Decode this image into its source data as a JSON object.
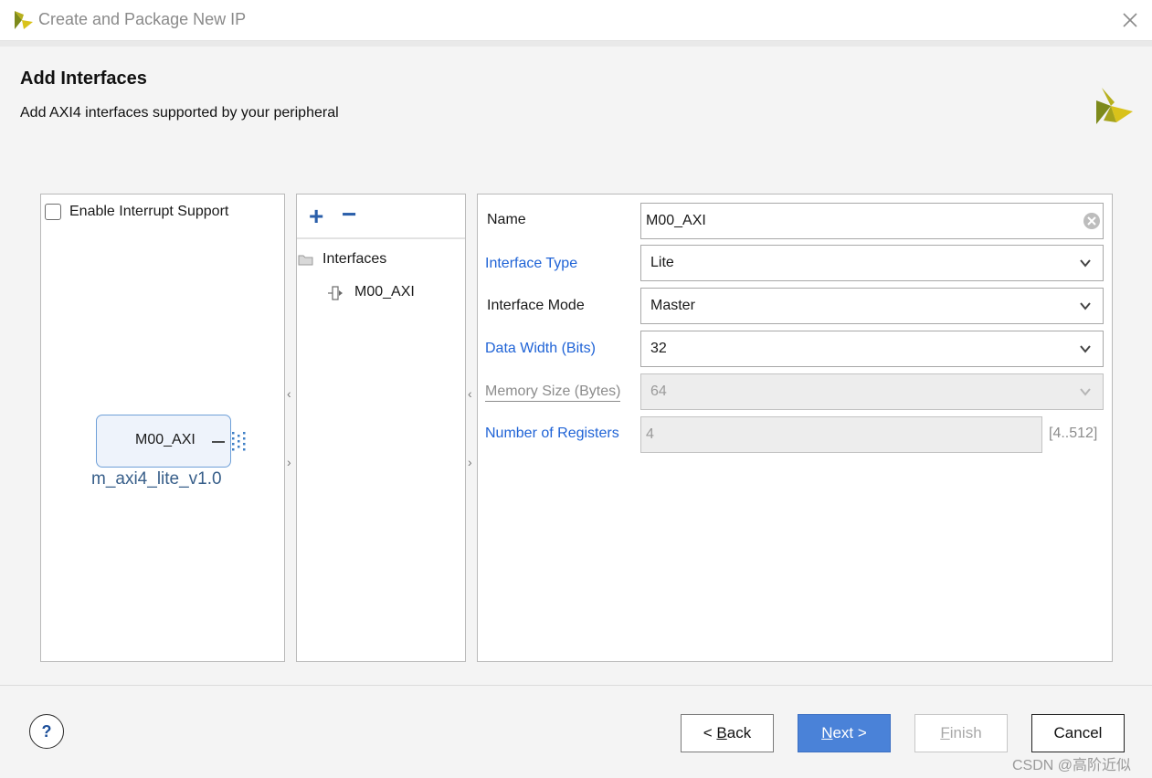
{
  "window": {
    "title": "Create and Package New IP"
  },
  "header": {
    "title": "Add Interfaces",
    "subtitle": "Add AXI4 interfaces supported by your peripheral"
  },
  "left_panel": {
    "interrupt_label": "Enable Interrupt Support",
    "interrupt_checked": false,
    "ip_port_label": "M00_AXI",
    "ip_name": "m_axi4_lite_v1.0"
  },
  "middle_panel": {
    "add_symbol": "+",
    "remove_symbol": "−",
    "tree": {
      "root": "Interfaces",
      "children": [
        "M00_AXI"
      ]
    }
  },
  "properties": {
    "name": {
      "label": "Name",
      "value": "M00_AXI"
    },
    "interface_type": {
      "label": "Interface Type",
      "value": "Lite"
    },
    "interface_mode": {
      "label": "Interface Mode",
      "value": "Master"
    },
    "data_width": {
      "label": "Data Width (Bits)",
      "value": "32"
    },
    "memory_size": {
      "label": "Memory Size (Bytes)",
      "value": "64"
    },
    "num_registers": {
      "label": "Number of Registers",
      "value": "4",
      "range": "[4..512]"
    }
  },
  "footer": {
    "help": "?",
    "back": {
      "mnemonic": "B",
      "label": "< Back"
    },
    "next": {
      "mnemonic": "N",
      "label": "Next >"
    },
    "finish": {
      "mnemonic": "F",
      "label": "Finish"
    },
    "cancel": "Cancel"
  },
  "watermark": "CSDN @高阶近似",
  "colors": {
    "accent_blue": "#1f63d6",
    "primary_button": "#4a82d8",
    "logo_yellow": "#d9c21a",
    "logo_olive": "#7d8a1b"
  },
  "icons": {
    "app": "vivado-logo-icon",
    "close": "close-icon",
    "clear": "clear-circle-icon",
    "folder": "folder-icon",
    "interface": "bus-interface-icon",
    "dropdown": "chevron-down-icon",
    "help": "help-icon"
  }
}
